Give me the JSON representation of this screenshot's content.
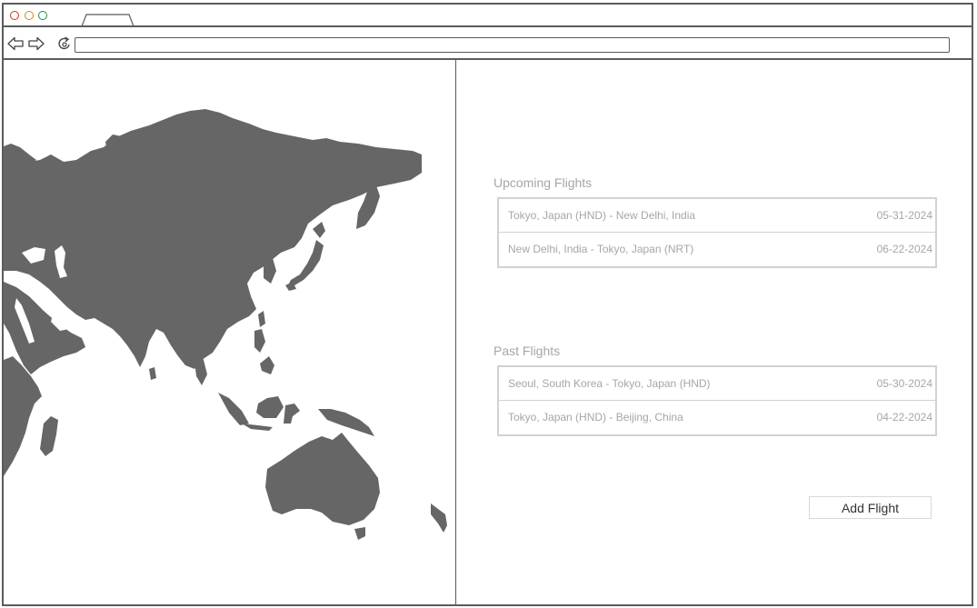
{
  "browser": {
    "controls": [
      "close-dot",
      "minimize-dot",
      "maximize-dot"
    ],
    "tab_label": "",
    "address": ""
  },
  "map": {
    "land_color": "#666666",
    "region": "Asia-Pacific"
  },
  "upcoming": {
    "title": "Upcoming Flights",
    "flights": [
      {
        "route": "Tokyo, Japan (HND) - New Delhi, India",
        "date": "05-31-2024"
      },
      {
        "route": "New Delhi, India - Tokyo, Japan (NRT)",
        "date": "06-22-2024"
      }
    ]
  },
  "past": {
    "title": "Past Flights",
    "flights": [
      {
        "route": "Seoul, South Korea - Tokyo, Japan (HND)",
        "date": "05-30-2024"
      },
      {
        "route": "Tokyo, Japan (HND) - Beijing, China",
        "date": "04-22-2024"
      }
    ]
  },
  "actions": {
    "add_flight_label": "Add Flight"
  },
  "colors": {
    "window_border": "#5b5b5b",
    "muted_text": "#a6a6a6",
    "list_border": "#d2d2d2"
  }
}
